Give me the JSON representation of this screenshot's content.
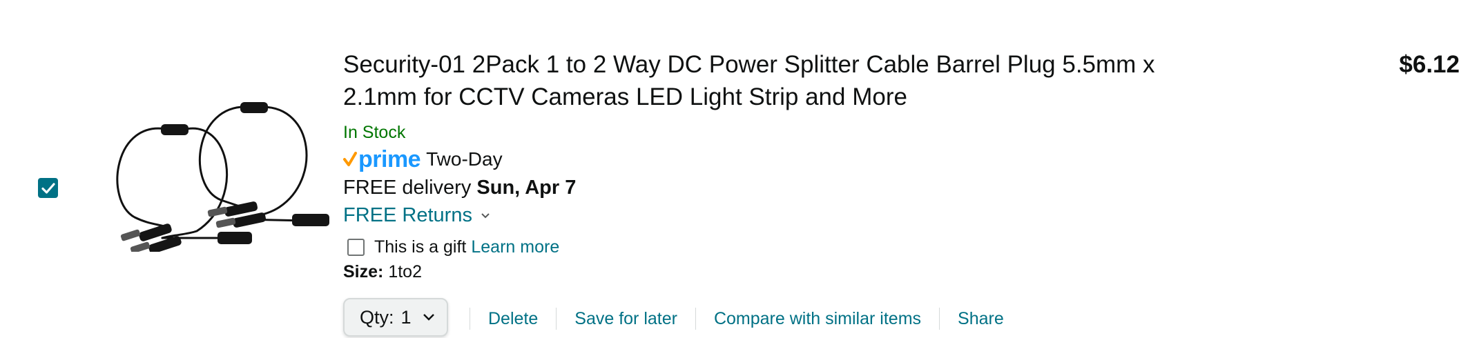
{
  "item": {
    "selected": true,
    "title": "Security-01 2Pack 1 to 2 Way DC Power Splitter Cable Barrel Plug 5.5mm x 2.1mm for CCTV Cameras LED Light Strip and More",
    "stock_status": "In Stock",
    "prime": {
      "word": "prime",
      "label": "Two-Day"
    },
    "delivery": {
      "prefix": "FREE delivery",
      "date": "Sun, Apr 7"
    },
    "returns_label": "FREE Returns",
    "gift": {
      "label": "This is a gift",
      "link": "Learn more"
    },
    "size": {
      "label": "Size:",
      "value": "1to2"
    },
    "quantity": {
      "label": "Qty:",
      "value": "1"
    },
    "actions": [
      "Delete",
      "Save for later",
      "Compare with similar items",
      "Share"
    ],
    "price": "$6.12"
  },
  "colors": {
    "link": "#007185",
    "stock": "#007600",
    "prime_blue": "#1a98ff",
    "prime_check": "#ff9900",
    "checkbox": "#007185"
  },
  "icons": {
    "select": "checkmark-icon",
    "prime": "prime-check-icon",
    "returns": "chevron-down-icon",
    "quantity": "chevron-down-icon"
  }
}
